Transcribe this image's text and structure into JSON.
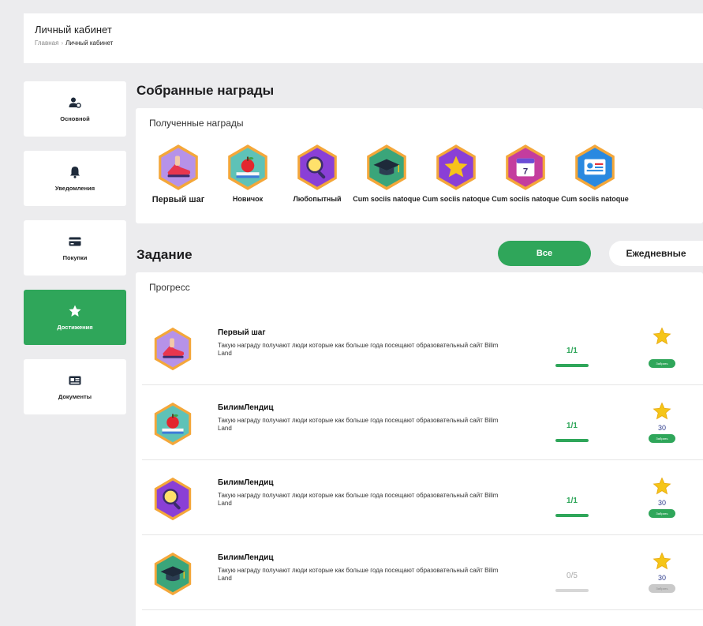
{
  "header": {
    "title": "Личный кабинет",
    "breadcrumb": {
      "home": "Главная",
      "separator": "›",
      "current": "Личный кабинет"
    }
  },
  "sidebar": {
    "items": [
      {
        "label": "Основной",
        "icon": "user-settings-icon",
        "active": false
      },
      {
        "label": "Уведомления",
        "icon": "bell-icon",
        "active": false
      },
      {
        "label": "Покупки",
        "icon": "credit-card-icon",
        "active": false
      },
      {
        "label": "Достижения",
        "icon": "star-icon",
        "active": true
      },
      {
        "label": "Документы",
        "icon": "id-card-icon",
        "active": false
      }
    ]
  },
  "awards": {
    "title": "Собранные награды",
    "subtitle": "Полученные награды",
    "badges": [
      {
        "name": "Первый шаг",
        "icon": "sneaker-icon"
      },
      {
        "name": "Новичок",
        "icon": "apple-books-icon"
      },
      {
        "name": "Любопытный",
        "icon": "magnifier-icon"
      },
      {
        "name": "Cum sociis natoque",
        "icon": "graduation-cap-icon"
      },
      {
        "name": "Cum sociis natoque",
        "icon": "star-badge-icon"
      },
      {
        "name": "Cum sociis natoque",
        "icon": "calendar-icon"
      },
      {
        "name": "Cum sociis natoque",
        "icon": "id-badge-icon"
      }
    ]
  },
  "tasks": {
    "title": "Задание",
    "filters": {
      "all": "Все",
      "daily": "Ежедневные"
    },
    "subtitle": "Прогресс",
    "items": [
      {
        "title": "Первый шаг",
        "description": "Такую награду получают люди которые как больше года посещают образовательный сайт Bilim Land",
        "progress": "1/1",
        "fraction": 1,
        "points": "",
        "claim": "Забрать",
        "icon": "sneaker-icon"
      },
      {
        "title": "БилимЛендиц",
        "description": "Такую награду получают люди которые как больше года посещают образовательный сайт Bilim Land",
        "progress": "1/1",
        "fraction": 1,
        "points": "30",
        "claim": "Забрать",
        "icon": "apple-books-icon"
      },
      {
        "title": "БилимЛендиц",
        "description": "Такую награду получают люди которые как больше года посещают образовательный сайт Bilim Land",
        "progress": "1/1",
        "fraction": 1,
        "points": "30",
        "claim": "Забрать",
        "icon": "magnifier-icon"
      },
      {
        "title": "БилимЛендиц",
        "description": "Такую награду получают люди которые как больше года посещают образовательный сайт Bilim Land",
        "progress": "0/5",
        "fraction": 0,
        "points": "30",
        "claim": "Забрать",
        "icon": "graduation-cap-icon"
      }
    ]
  },
  "colors": {
    "accent": "#2fa65a",
    "hex_border": "#f4a73a",
    "hex_purple": "#8a3fd6",
    "star": "#f5c518"
  }
}
